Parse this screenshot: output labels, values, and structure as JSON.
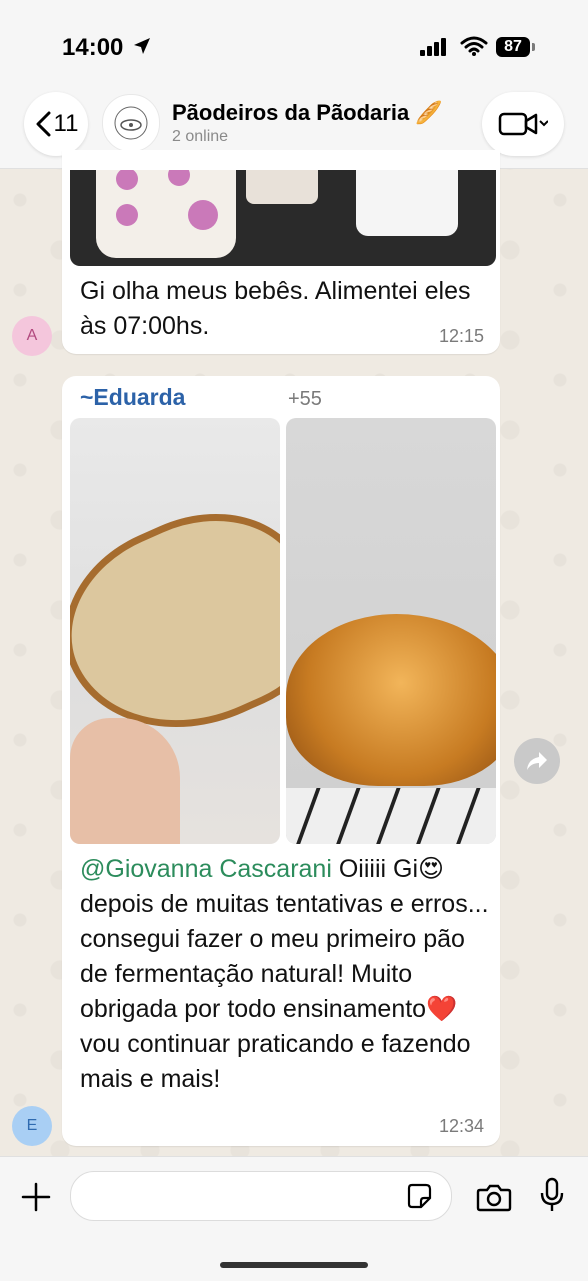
{
  "status_bar": {
    "time": "14:00",
    "battery": "87"
  },
  "header": {
    "back_count": "11",
    "group_name": "Pãodeiros da Pãodaria 🥖",
    "subtitle": "2 online"
  },
  "messages": [
    {
      "sender_initial": "A",
      "text": "Gi olha meus bebês. Alimentei eles às 07:00hs.",
      "time": "12:15"
    },
    {
      "sender_initial": "E",
      "sender_name": "~Eduarda",
      "sender_phone": "+55 ",
      "mention": "@Giovanna Cascarani",
      "text": " Oiiiii Gi😍 depois de muitas tentativas e erros... consegui fazer o meu primeiro pão de fermentação natural! Muito obrigada por todo ensinamento❤️ vou continuar praticando e fazendo mais e mais!",
      "time": "12:34"
    }
  ],
  "input": {
    "placeholder": ""
  },
  "colors": {
    "sender_name": "#2c62a8",
    "mention": "#2c8c5c",
    "background": "#efeae2"
  }
}
